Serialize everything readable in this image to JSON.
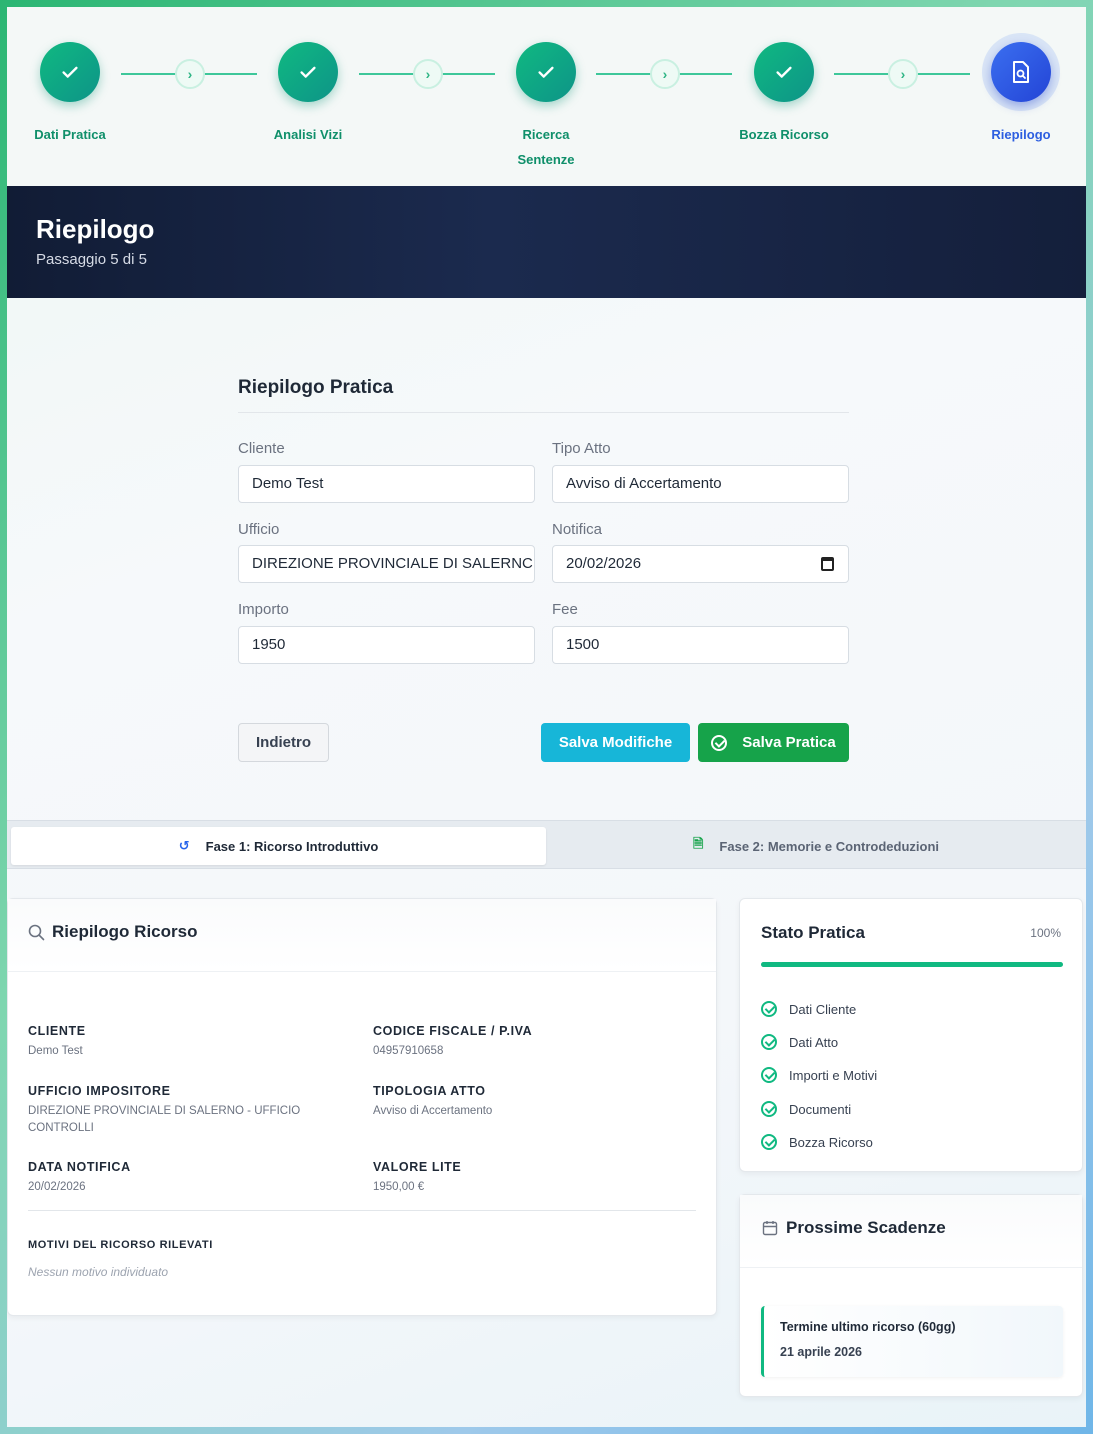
{
  "stepper": {
    "steps": [
      {
        "label": "Dati Pratica",
        "state": "done"
      },
      {
        "label": "Analisi Vizi",
        "state": "done"
      },
      {
        "label": "Ricerca Sentenze",
        "state": "done"
      },
      {
        "label": "Bozza Ricorso",
        "state": "done"
      },
      {
        "label": "Riepilogo",
        "state": "active"
      }
    ]
  },
  "header": {
    "title": "Riepilogo",
    "subtitle": "Passaggio 5 di 5"
  },
  "form": {
    "title": "Riepilogo Pratica",
    "cliente_label": "Cliente",
    "cliente_value": "Demo Test",
    "tipo_label": "Tipo Atto",
    "tipo_value": "Avviso di Accertamento",
    "ufficio_label": "Ufficio",
    "ufficio_value": "DIREZIONE PROVINCIALE DI SALERNC",
    "notifica_label": "Notifica",
    "notifica_value": "20/02/2026",
    "importo_label": "Importo",
    "importo_value": "1950",
    "fee_label": "Fee",
    "fee_value": "1500",
    "back_label": "Indietro",
    "save_changes_label": "Salva Modifiche",
    "save_practice_label": "Salva Pratica"
  },
  "tabs": [
    {
      "label": "Fase 1: Ricorso Introduttivo",
      "icon": "history-icon",
      "active": true
    },
    {
      "label": "Fase 2: Memorie e Controdeduzioni",
      "icon": "file-icon",
      "active": false
    }
  ],
  "summary": {
    "title": "Riepilogo Ricorso",
    "cliente_k": "CLIENTE",
    "cliente_v": "Demo Test",
    "cf_k": "CODICE FISCALE / P.IVA",
    "cf_v": "04957910658",
    "ufficio_k": "UFFICIO IMPOSITORE",
    "ufficio_v": "DIREZIONE PROVINCIALE DI SALERNO - UFFICIO CONTROLLI",
    "tipologia_k": "TIPOLOGIA ATTO",
    "tipologia_v": "Avviso di Accertamento",
    "data_k": "DATA NOTIFICA",
    "data_v": "20/02/2026",
    "valore_k": "VALORE LITE",
    "valore_v": "1950,00 €",
    "motivi_k": "MOTIVI DEL RICORSO RILEVATI",
    "motivi_v": "Nessun motivo individuato"
  },
  "status": {
    "title": "Stato Pratica",
    "percent_label": "100%",
    "progress": 1.0,
    "items": [
      "Dati Cliente",
      "Dati Atto",
      "Importi e Motivi",
      "Documenti",
      "Bozza Ricorso"
    ]
  },
  "deadlines": {
    "title": "Prossime Scadenze",
    "item_title": "Termine ultimo ricorso (60gg)",
    "item_date": "21 aprile 2026"
  },
  "colors": {
    "accent_green": "#10b981",
    "accent_blue": "#2c5ee0",
    "header_bg": "#111c35",
    "save_changes": "#17b6d8",
    "save_practice": "#16a34a"
  }
}
